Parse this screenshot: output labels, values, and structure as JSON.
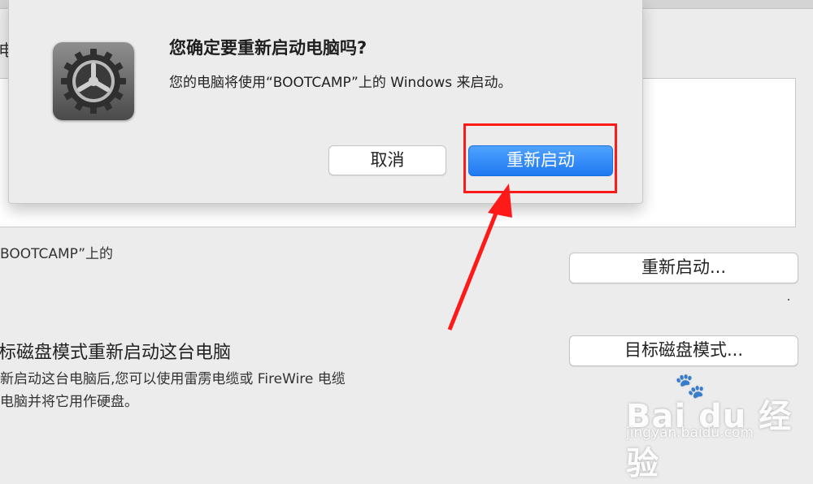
{
  "window": {
    "title_fragment": "电"
  },
  "dialog": {
    "title": "您确定要重新启动电脑吗?",
    "message": "您的电脑将使用“BOOTCAMP”上的 Windows 来启动。",
    "cancel_label": "取消",
    "confirm_label": "重新启动",
    "icon": "gear-icon"
  },
  "main": {
    "startup_desc": "BOOTCAMP”上的",
    "restart_button_label": "重新启动...",
    "target_disk_title": "标磁盘模式重新启动这台电脑",
    "target_disk_desc_line1": "新启动这台电脑后,您可以使用雷雳电缆或 FireWire 电缆",
    "target_disk_desc_line2": "电脑并将它用作硬盘。",
    "target_disk_button_label": "目标磁盘模式..."
  },
  "annotation": {
    "highlight_color": "#ff1a1a"
  },
  "watermark": {
    "logo": "Bai du 经验",
    "url": "jingyan.baidu.com"
  },
  "colors": {
    "primary_button": "#1f78f0",
    "background": "#ececec"
  }
}
